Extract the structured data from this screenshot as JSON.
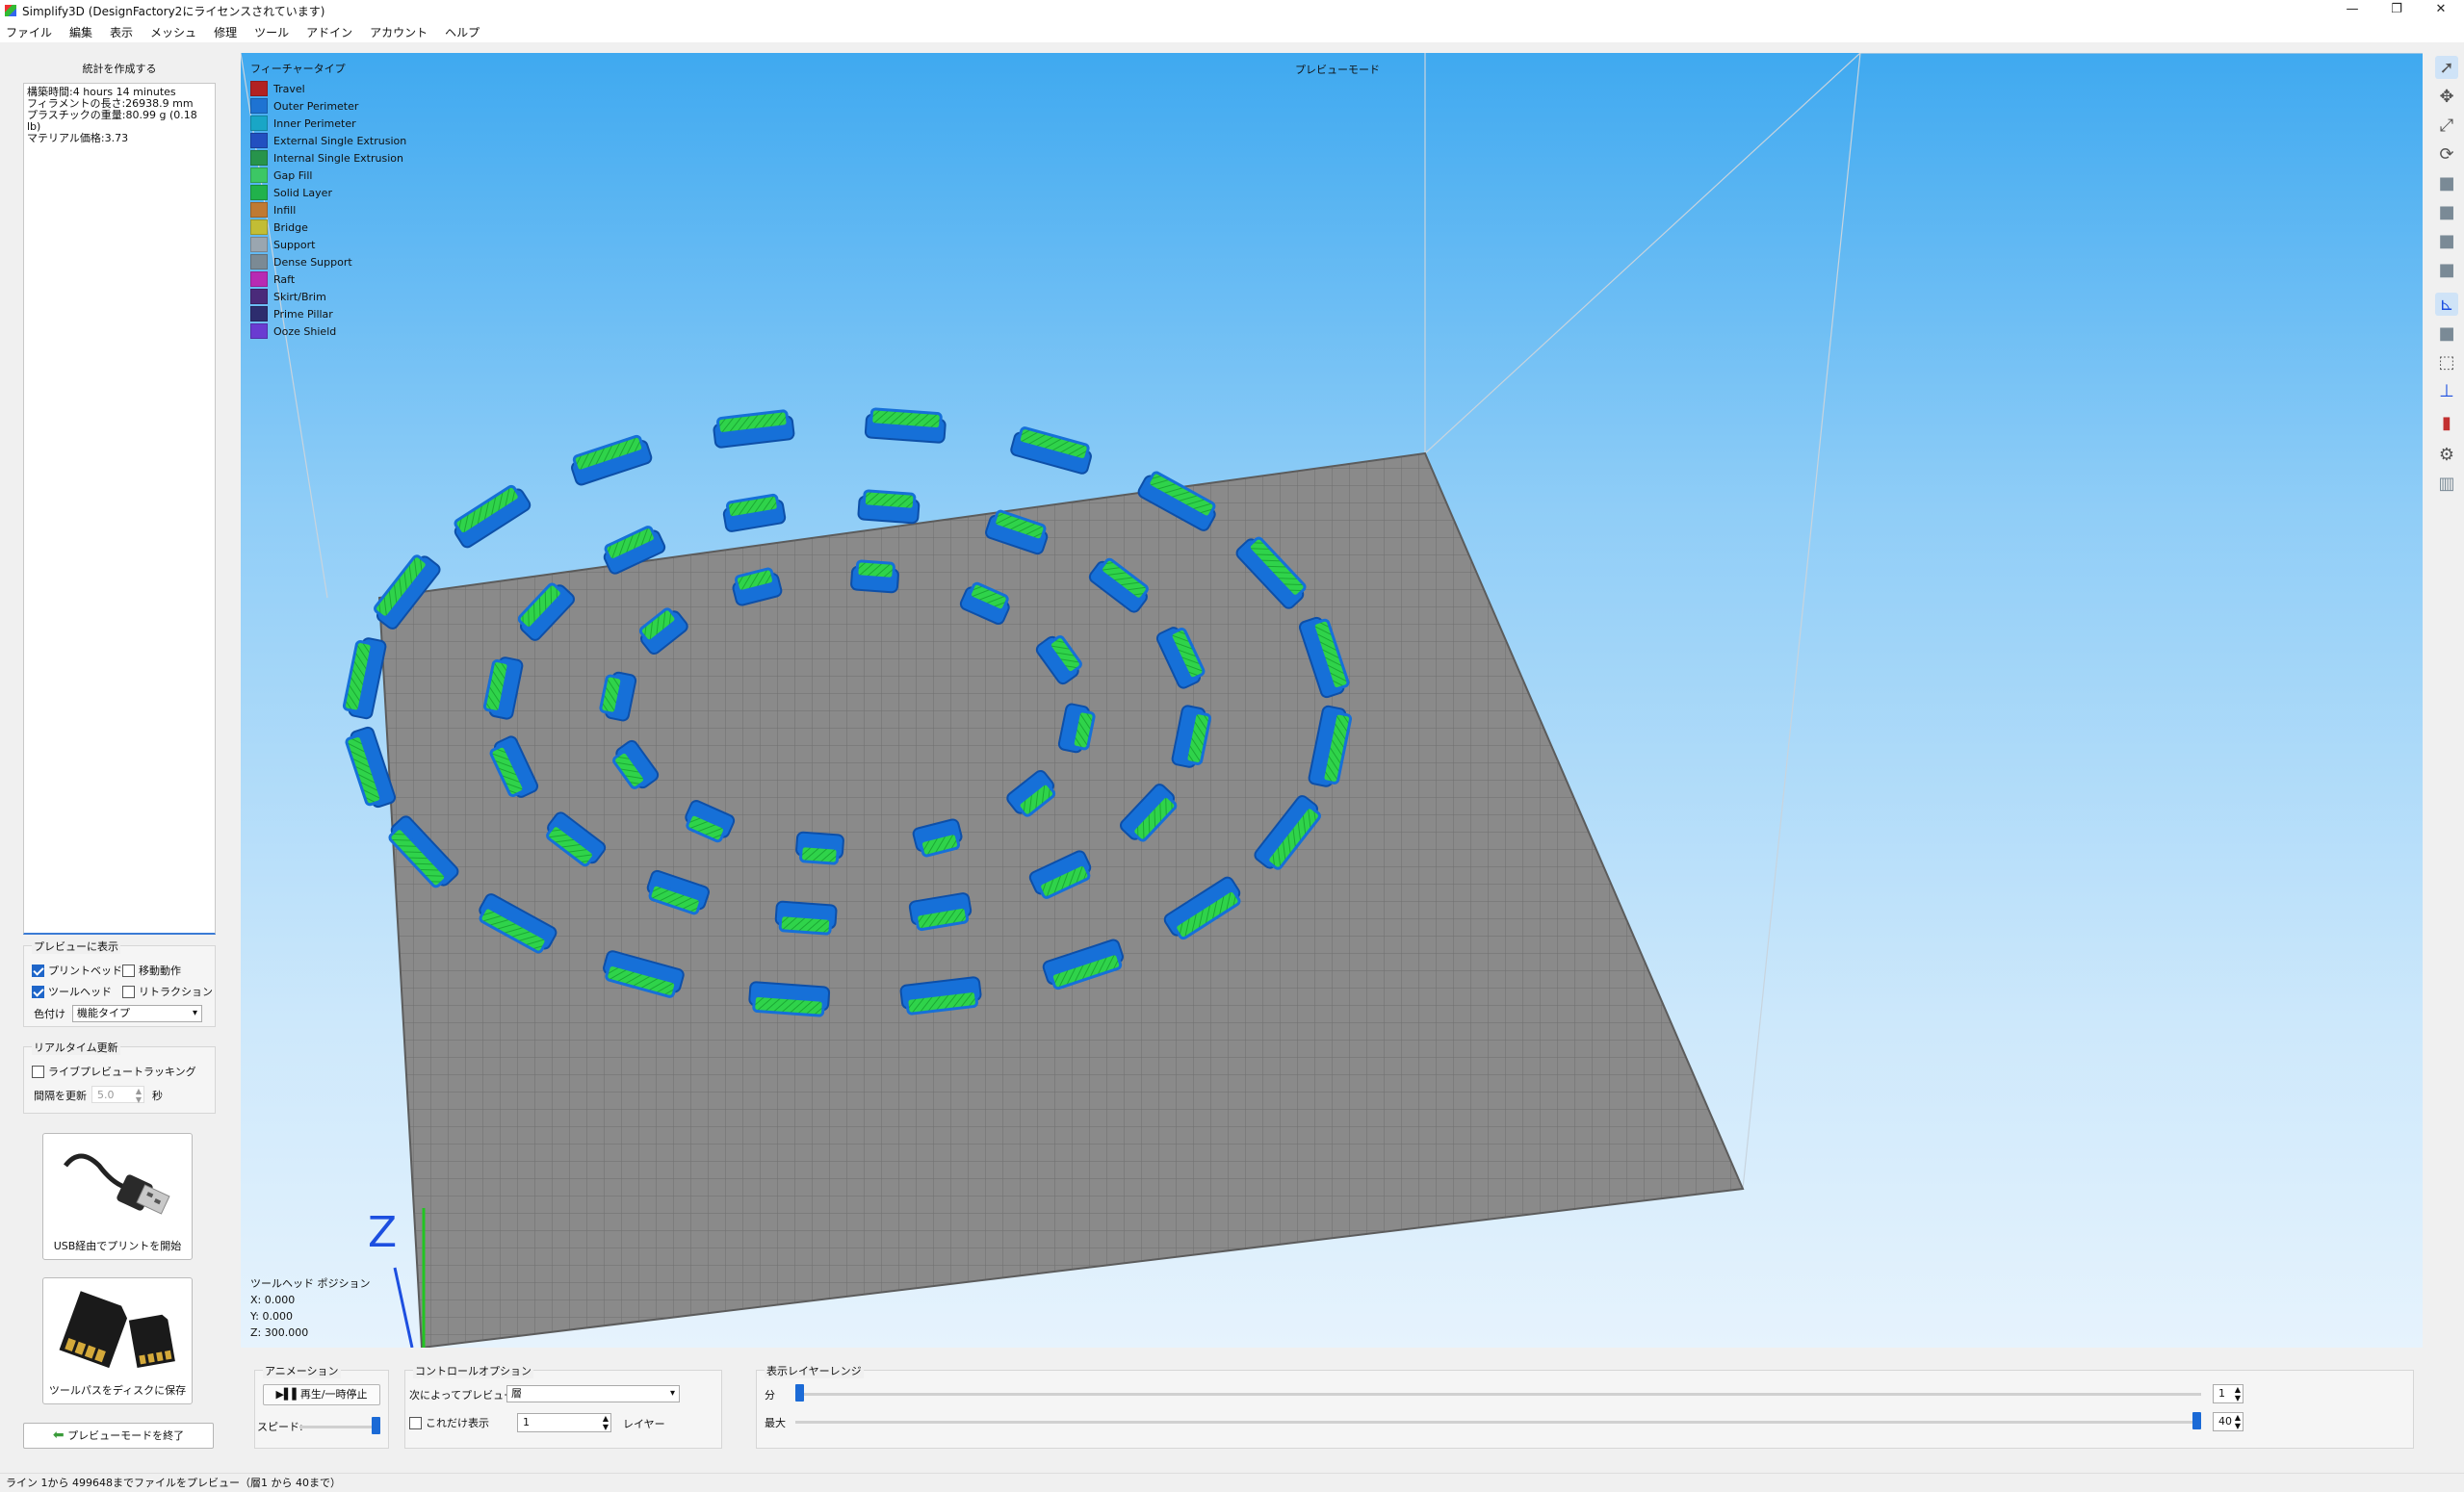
{
  "window": {
    "title": "Simplify3D (DesignFactory2にライセンスされています)",
    "controls": [
      "—",
      "❐",
      "✕"
    ]
  },
  "menu": [
    "ファイル",
    "編集",
    "表示",
    "メッシュ",
    "修理",
    "ツール",
    "アドイン",
    "アカウント",
    "ヘルプ"
  ],
  "left": {
    "stats_button": "統計を作成する",
    "stats": [
      "構築時間:4 hours 14 minutes",
      "フィラメントの長さ:26938.9 mm",
      "プラスチックの重量:80.99 g (0.18 lb)",
      "マテリアル価格:3.73"
    ],
    "preview_group": {
      "title": "プレビューに表示",
      "printbed": "プリントベッド",
      "travel": "移動動作",
      "toolhead": "ツールヘッド",
      "retraction": "リトラクション",
      "color_label": "色付け",
      "color_value": "機能タイプ"
    },
    "realtime_group": {
      "title": "リアルタイム更新",
      "tracking": "ライブプレビュートラッキング",
      "interval_label": "間隔を更新",
      "interval_value": "5.0",
      "interval_unit": "秒"
    },
    "usb_label": "USB経由でプリントを開始",
    "sd_label": "ツールパスをディスクに保存",
    "exit_label": "プレビューモードを終了"
  },
  "viewport": {
    "legend_title": "フィーチャータイプ",
    "mode_label": "プレビューモード",
    "legend": [
      {
        "name": "Travel",
        "color": "#b22222"
      },
      {
        "name": "Outer Perimeter",
        "color": "#1e73d2"
      },
      {
        "name": "Inner Perimeter",
        "color": "#19a6c6"
      },
      {
        "name": "External Single Extrusion",
        "color": "#2250c0"
      },
      {
        "name": "Internal Single Extrusion",
        "color": "#27944c"
      },
      {
        "name": "Gap Fill",
        "color": "#3cc765"
      },
      {
        "name": "Solid Layer",
        "color": "#21b24b"
      },
      {
        "name": "Infill",
        "color": "#c07a33"
      },
      {
        "name": "Bridge",
        "color": "#c2bd35"
      },
      {
        "name": "Support",
        "color": "#9aa6b0"
      },
      {
        "name": "Dense Support",
        "color": "#7b8a94"
      },
      {
        "name": "Raft",
        "color": "#b72ab3"
      },
      {
        "name": "Skirt/Brim",
        "color": "#4a2a7a"
      },
      {
        "name": "Prime Pillar",
        "color": "#2d2d6e"
      },
      {
        "name": "Ooze Shield",
        "color": "#6a3bd1"
      }
    ],
    "toolhead": {
      "title": "ツールヘッド ポジション",
      "x": "X: 0.000",
      "y": "Y: 0.000",
      "z": "Z: 300.000"
    },
    "axis_label": "Z"
  },
  "bottom": {
    "animation_title": "アニメーション",
    "play_label": "▶▌▌再生/一時停止",
    "speed_label": "スピード:",
    "speed_value": 1.0,
    "control_title": "コントロールオプション",
    "preview_by_label": "次によってプレビュー",
    "preview_by_value": "層",
    "only_label": "これだけ表示",
    "only_value": "1",
    "layer_label": "レイヤー",
    "range_title": "表示レイヤーレンジ",
    "min_label": "分",
    "min_value": "1",
    "min_level": 0.0,
    "max_label": "最大",
    "max_value": "40",
    "max_level": 1.0
  },
  "status": "ライン 1から 499648までファイルをプレビュー（層1 から 40まで）"
}
